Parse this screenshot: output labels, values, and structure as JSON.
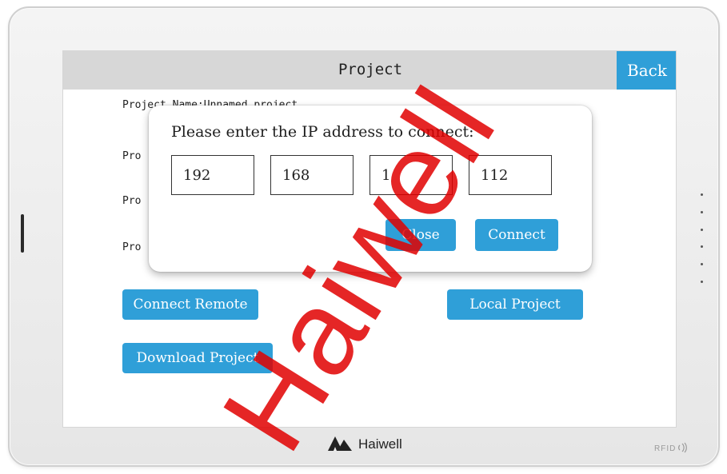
{
  "screen": {
    "title": "Project",
    "back_label": "Back",
    "info_lines": [
      "Project Name:Unnamed project",
      "Pro",
      "Pro",
      "Pro"
    ]
  },
  "buttons": {
    "connect_remote": "Connect Remote",
    "local_project": "Local Project",
    "download_project": "Download Project"
  },
  "dialog": {
    "prompt": "Please enter the IP address to connect:",
    "ip_octets": [
      "192",
      "168",
      "1",
      "112"
    ],
    "close_label": "Close",
    "connect_label": "Connect"
  },
  "device": {
    "brand": "Haiwell",
    "rfid_label": "RFID"
  },
  "watermark": "Haiwell",
  "colors": {
    "accent": "#2f9fd8",
    "titlebar": "#d7d7d7",
    "watermark": "#e10000"
  },
  "icons": {
    "logo": "haiwell-logo-icon",
    "nfc": "nfc-icon"
  }
}
